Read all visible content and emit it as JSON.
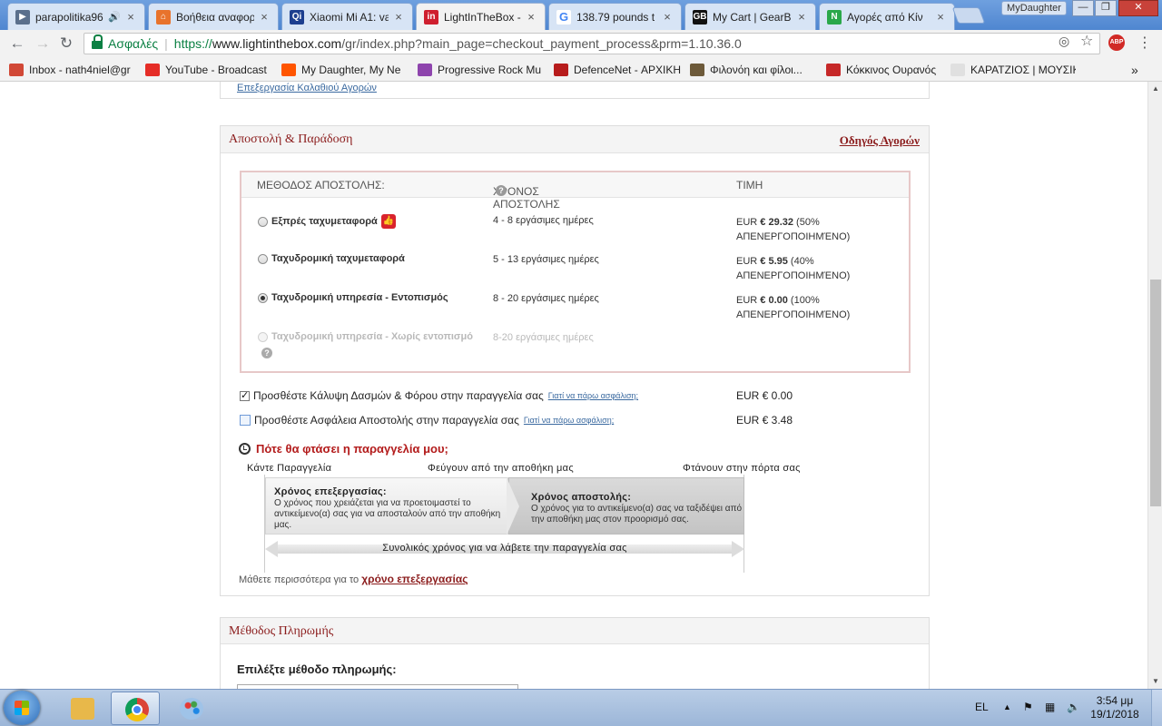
{
  "browser": {
    "tabs": [
      {
        "label": "parapolitika96",
        "color": "#5a6f8c",
        "glyph": "▶"
      },
      {
        "label": "Βοήθεια αναφορ",
        "color": "#e8732c",
        "glyph": "⌂"
      },
      {
        "label": "Xiaomi Mi A1: va",
        "color": "#1d3f8f",
        "glyph": "Qi"
      },
      {
        "label": "LightInTheBox - ",
        "color": "#cf1f2e",
        "glyph": "in"
      },
      {
        "label": "138.79 pounds t",
        "color": "#ffffff",
        "glyph": "G"
      },
      {
        "label": "My Cart | GearB",
        "color": "#111111",
        "glyph": "GB"
      },
      {
        "label": "Αγορές από Κίν",
        "color": "#2aa84a",
        "glyph": "N"
      }
    ],
    "active_tab": 3,
    "profile_name": "MyDaughter",
    "window_buttons": {
      "minimize": "—",
      "maximize": "❐",
      "close": "✕"
    },
    "nav": {
      "back": "←",
      "forward": "→",
      "reload": "↻"
    },
    "secure_label": "Ασφαλές",
    "url_scheme": "https://",
    "url_host": "www.lightinthebox.com",
    "url_path": "/gr/index.php?main_page=checkout_payment_process&prm=1.10.36.0",
    "star_icon": "☆",
    "abp_label": "ABP",
    "menu_icon": "⋮",
    "bookmarks": [
      {
        "label": "Inbox - nath4niel@gr",
        "color": "#d14836"
      },
      {
        "label": "YouTube - Broadcast",
        "color": "#e52d27"
      },
      {
        "label": "My Daughter, My Ne",
        "color": "#ff5500"
      },
      {
        "label": "Progressive Rock Mu",
        "color": "#8e44ad"
      },
      {
        "label": "DefenceNet - ΑΡΧΙΚΗ",
        "color": "#b71c1c"
      },
      {
        "label": "Φιλονόη και φίλοι...",
        "color": "#6d5a3a"
      },
      {
        "label": "Κόκκινος Ουρανός",
        "color": "#c62828"
      },
      {
        "label": "ΚΑΡΑΤΖΙΟΣ | ΜΟΥΣΙΚ",
        "color": "#e0e0e0"
      }
    ],
    "bookmarks_overflow": "»"
  },
  "page": {
    "top_link": "Επεξεργασία Καλαθιού Αγορών",
    "shipping": {
      "title": "Αποστολή & Παράδοση",
      "guide_link": "Οδηγός Αγορών",
      "columns": {
        "method": "ΜΕΘΟΔΟΣ ΑΠΟΣΤΟΛΗΣ:",
        "time": "ΧΡΟΝΟΣ ΑΠΟΣΤΟΛΗΣ",
        "price": "ΤΙΜΗ"
      },
      "rows": [
        {
          "method": "Εξπρές ταχυμεταφορά",
          "time": "4 - 8 εργάσιμες ημέρες",
          "price_prefix": "EUR ",
          "price_amount": "€ 29.32",
          "price_note": " (50%",
          "price_note2": "ΑΠΕΝΕΡΓΟΠΟΙΗΜΈΝΟ)",
          "selected": false,
          "disabled": false
        },
        {
          "method": "Ταχυδρομική ταχυμεταφορά",
          "time": "5 - 13 εργάσιμες ημέρες",
          "price_prefix": "EUR ",
          "price_amount": "€ 5.95",
          "price_note": " (40%",
          "price_note2": "ΑΠΕΝΕΡΓΟΠΟΙΗΜΈΝΟ)",
          "selected": false,
          "disabled": false
        },
        {
          "method": "Ταχυδρομική υπηρεσία - Εντοπισμός",
          "time": "8 - 20 εργάσιμες ημέρες",
          "price_prefix": "EUR ",
          "price_amount": "€ 0.00",
          "price_note": " (100%",
          "price_note2": "ΑΠΕΝΕΡΓΟΠΟΙΗΜΈΝΟ)",
          "selected": true,
          "disabled": false
        },
        {
          "method": "Ταχυδρομική υπηρεσία - Χωρίς εντοπισμό",
          "time": "8-20 εργάσιμες ημέρες",
          "selected": false,
          "disabled": true
        }
      ],
      "options": [
        {
          "label": "Προσθέστε Κάλυψη Δασμών & Φόρου στην παραγγελία σας",
          "link": "Γιατί να πάρω ασφάλιση;",
          "price": "EUR € 0.00",
          "checked": true
        },
        {
          "label": "Προσθέστε Ασφάλεια Αποστολής στην παραγγελία σας",
          "link": "Γιατί να πάρω ασφάλιση;",
          "price": "EUR € 3.48",
          "checked": false
        }
      ],
      "arrival": {
        "title": "Πότε θα φτάσει η παραγγελία μου;",
        "labels": {
          "order": "Κάντε Παραγγελία",
          "leave": "Φεύγουν από την αποθήκη μας",
          "arrive": "Φτάνουν στην πόρτα σας"
        },
        "processing_title": "Χρόνος επεξεργασίας:",
        "processing_text": "Ο χρόνος που χρειάζεται για να προετοιμαστεί το αντικείμενο(α) σας για να αποσταλούν από την αποθήκη μας.",
        "shipping_title": "Χρόνος αποστολής:",
        "shipping_text": "Ο χρόνος για το αντικείμενο(α) σας να ταξιδέψει από την αποθήκη μας στον προορισμό σας.",
        "total": "Συνολικός χρόνος για να λάβετε την παραγγελία σας"
      },
      "learn_more_prefix": "Μάθετε περισσότερα για το ",
      "learn_more_link": "χρόνο επεξεργασίας"
    },
    "payment": {
      "title": "Μέθοδος Πληρωμής",
      "choose_label": "Επιλέξτε μέθοδο πληρωμής:"
    }
  },
  "taskbar": {
    "apps": [
      {
        "name": "explorer",
        "color": "#e8b84a"
      },
      {
        "name": "chrome",
        "color": "#4285f4"
      },
      {
        "name": "paint",
        "color": "#9fc3e8"
      }
    ],
    "language": "EL",
    "tray_up": "▲",
    "time": "3:54 μμ",
    "date": "19/1/2018"
  }
}
